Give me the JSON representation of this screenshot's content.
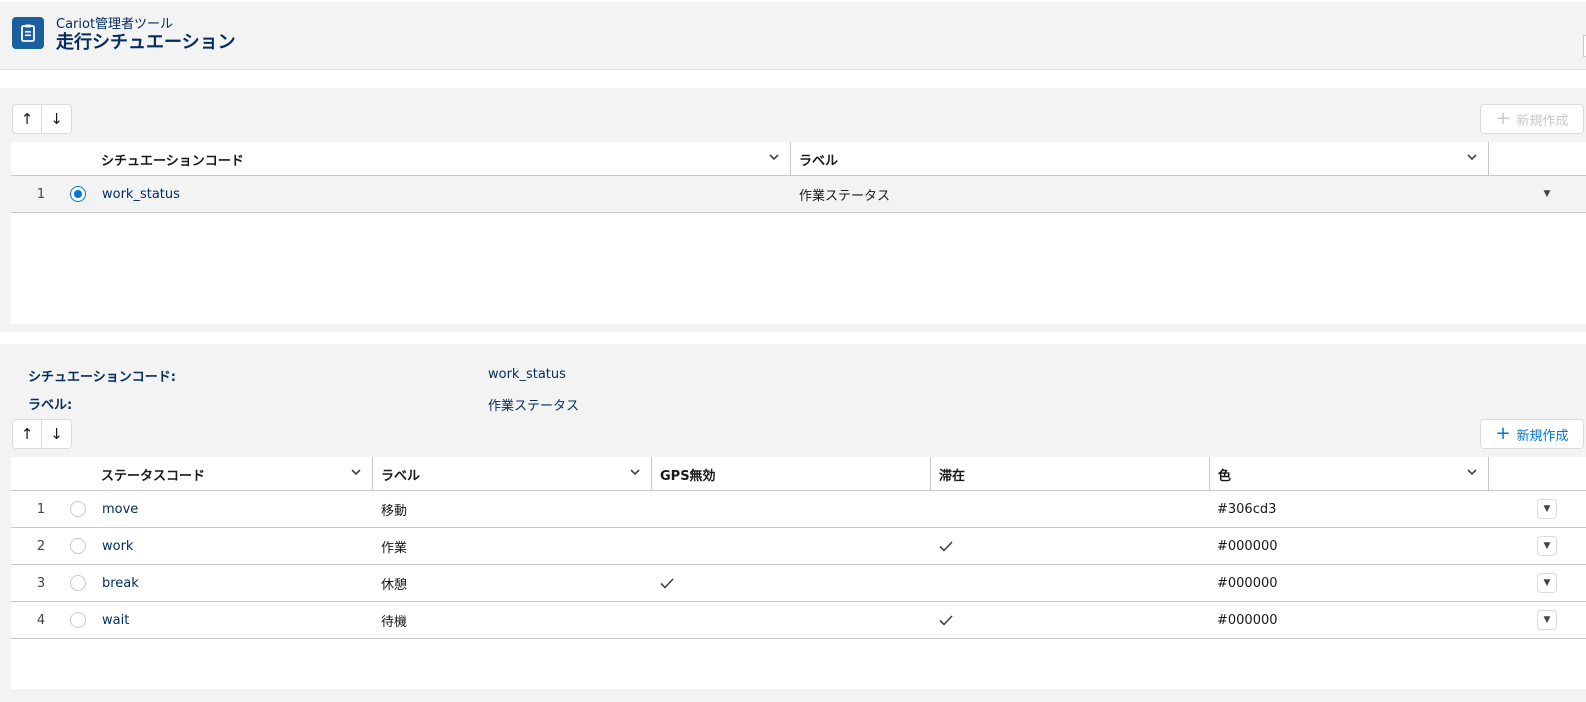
{
  "header": {
    "app_name": "Cariot管理者ツール",
    "title": "走行シチュエーション",
    "icon": "clipboard-icon"
  },
  "situations": {
    "sort_up": "↑",
    "sort_down": "↓",
    "new_button_label": "新規作成",
    "columns": [
      "シチュエーションコード",
      "ラベル"
    ],
    "rows": [
      {
        "num": "1",
        "code": "work_status",
        "label": "作業ステータス",
        "selected": true
      }
    ]
  },
  "detail": {
    "code_label": "シチュエーションコード:",
    "code_value": "work_status",
    "label_label": "ラベル:",
    "label_value": "作業ステータス"
  },
  "statuses": {
    "new_button_label": "新規作成",
    "columns": [
      "ステータスコード",
      "ラベル",
      "GPS無効",
      "滞在",
      "色"
    ],
    "rows": [
      {
        "num": "1",
        "code": "move",
        "label": "移動",
        "gps_disabled": false,
        "stay": false,
        "color": "#306cd3"
      },
      {
        "num": "2",
        "code": "work",
        "label": "作業",
        "gps_disabled": false,
        "stay": true,
        "color": "#000000"
      },
      {
        "num": "3",
        "code": "break",
        "label": "休憩",
        "gps_disabled": true,
        "stay": false,
        "color": "#000000"
      },
      {
        "num": "4",
        "code": "wait",
        "label": "待機",
        "gps_disabled": false,
        "stay": true,
        "color": "#000000"
      }
    ]
  },
  "colors": {
    "brand": "#1b5f9e",
    "accent": "#0176d3",
    "title": "#032d60"
  }
}
